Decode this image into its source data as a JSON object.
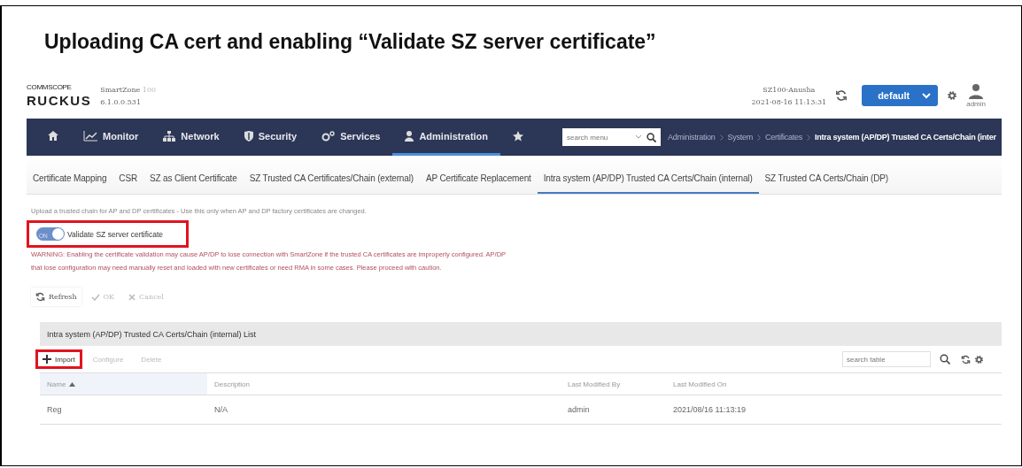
{
  "slide_title": "Uploading CA cert and enabling “Validate SZ server certificate”",
  "header": {
    "brand_top": "COMMSCOPE",
    "brand": "RUCKUS",
    "product": "SmartZone",
    "model": "100",
    "version": "6.1.0.0.531",
    "controller": "SZ100-Anusha",
    "datetime": "2021-08-16 11:13:31",
    "domain": "default",
    "user": "admin"
  },
  "nav": {
    "items": [
      {
        "kind": "home",
        "selected": false
      },
      {
        "kind": "monitor",
        "label": "Monitor",
        "selected": false
      },
      {
        "kind": "network",
        "label": "Network",
        "selected": false
      },
      {
        "kind": "security",
        "label": "Security",
        "selected": false
      },
      {
        "kind": "services",
        "label": "Services",
        "selected": false
      },
      {
        "kind": "admin",
        "label": "Administration",
        "selected": true
      },
      {
        "kind": "star",
        "selected": false
      }
    ],
    "search": {
      "placeholder": "search menu"
    },
    "breadcrumb": [
      "Administration",
      "System",
      "Certificates",
      "Intra system (AP/DP) Trusted CA Certs/Chain (inter"
    ]
  },
  "tabs": [
    {
      "label": "Certificate Mapping",
      "selected": false
    },
    {
      "label": "CSR",
      "selected": false
    },
    {
      "label": "SZ as Client Certificate",
      "selected": false
    },
    {
      "label": "SZ Trusted CA Certificates/Chain (external)",
      "selected": false
    },
    {
      "label": "AP Certificate Replacement",
      "selected": false
    },
    {
      "label": "Intra system (AP/DP) Trusted CA Certs/Chain (internal)",
      "selected": true
    },
    {
      "label": "SZ Trusted CA Certs/Chain (DP)",
      "selected": false
    }
  ],
  "description": "Upload a trusted chain for AP and DP certificates - Use this only when AP and DP factory certificates are changed.",
  "toggle": {
    "state_label": "ON",
    "on": true,
    "label": "Validate SZ server certificate",
    "highlighted": true
  },
  "warning": [
    "WARNING: Enabling the certificate validation may cause AP/DP to lose connection with SmartZone if the trusted CA certificates are improperly configured. AP/DP",
    "that lose configuration may need manually reset and loaded with new certificates or need RMA in some cases. Please proceed with caution."
  ],
  "actions": [
    {
      "kind": "refresh",
      "label": "Refresh",
      "disabled": false
    },
    {
      "kind": "ok",
      "label": "OK",
      "disabled": true
    },
    {
      "kind": "cancel",
      "label": "Cancel",
      "disabled": true
    }
  ],
  "list": {
    "title": "Intra system (AP/DP) Trusted CA Certs/Chain (internal) List",
    "tools": [
      {
        "kind": "import",
        "label": "Import",
        "disabled": false,
        "highlighted": true
      },
      {
        "kind": "plain",
        "label": "Configure",
        "disabled": true,
        "highlighted": false
      },
      {
        "kind": "plain",
        "label": "Delete",
        "disabled": true,
        "highlighted": false
      }
    ],
    "search": {
      "placeholder": "search table"
    },
    "columns": [
      {
        "label": "Name",
        "sorted": true
      },
      {
        "label": "Description",
        "sorted": false
      },
      {
        "label": "Last Modified By",
        "sorted": false
      },
      {
        "label": "Last Modified On",
        "sorted": false
      }
    ],
    "rows": [
      [
        "Reg",
        "N/A",
        "admin",
        "2021/08/16 11:13:19"
      ]
    ]
  }
}
